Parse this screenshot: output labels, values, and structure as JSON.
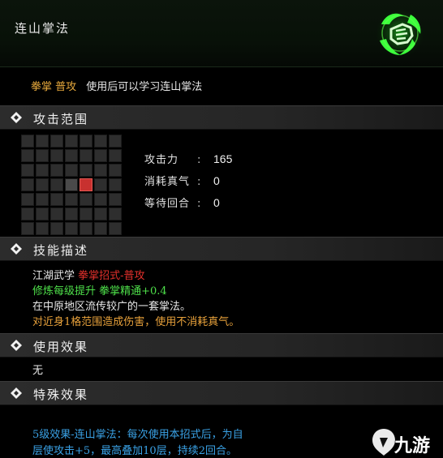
{
  "skill": {
    "name": "连山掌法",
    "type_label": "拳掌 普攻",
    "learn_text": "使用后可以学习连山掌法"
  },
  "sections": {
    "attack_range": "攻击范围",
    "skill_description": "技能描述",
    "use_effect": "使用效果",
    "special_effect": "特殊效果"
  },
  "range_grid": {
    "rows": 7,
    "cols": 7,
    "center": [
      3,
      3
    ],
    "highlighted": [
      [
        3,
        4
      ]
    ]
  },
  "stats": [
    {
      "key": "攻击力",
      "value": "165"
    },
    {
      "key": "消耗真气",
      "value": "0"
    },
    {
      "key": "等待回合",
      "value": "0"
    }
  ],
  "description": {
    "line1_prefix": "江湖武学",
    "line1_red": "拳掌招式-普攻",
    "line2_green": "修炼每级提升 拳掌精通+0.4",
    "line3": "在中原地区流传较广的一套掌法。",
    "line4": "对近身1格范围造成伤害，使用不消耗真气。"
  },
  "use_effect_value": "无",
  "special_effect_lines": [
    "5级效果-连山掌法：每次使用本招式后，为自",
    "层使攻击+5，最高叠加10层，持续2回合。"
  ],
  "watermark": "九游",
  "colors": {
    "accent_orange": "#e7a93c",
    "accent_red": "#e2302b",
    "accent_green": "#4ee04a",
    "accent_blue": "#3aa2e6",
    "icon_glow": "#3cff3c"
  }
}
